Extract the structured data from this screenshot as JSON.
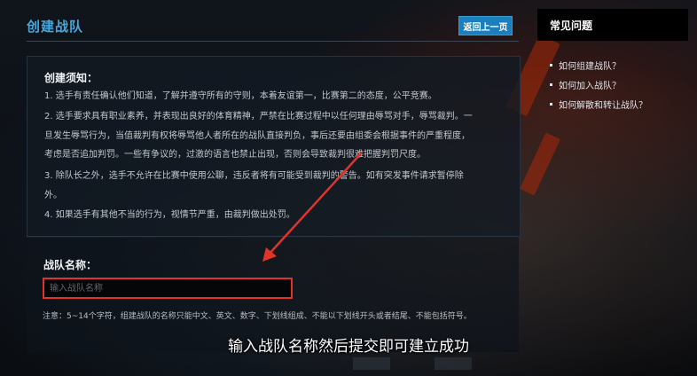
{
  "page": {
    "title": "创建战队",
    "back_button": "返回上一页"
  },
  "notice": {
    "heading": "创建须知：",
    "rules": [
      "1. 选手有责任确认他们知道，了解并遵守所有的守则，本着友谊第一，比赛第二的态度，公平竞赛。",
      "2. 选手要求具有职业素养，并表现出良好的体育精神，严禁在比赛过程中以任何理由辱骂对手，辱骂裁判。一",
      "旦发生辱骂行为，当值裁判有权将辱骂他人者所在的战队直接判负，事后还要由组委会根据事件的严重程度，",
      "考虑是否追加判罚。一些有争议的，过激的语言也禁止出现，否则会导致裁判很难把握判罚尺度。",
      "3. 除队长之外，选手不允许在比赛中使用公聊，违反者将有可能受到裁判的警告。如有突发事件请求暂停除",
      "外。",
      "4. 如果选手有其他不当的行为，视情节严重，由裁判做出处罚。"
    ]
  },
  "team_name": {
    "label": "战队名称：",
    "placeholder": "输入战队名称",
    "value": "",
    "hint": "注意：5~14个字符，组建战队的名称只能中文、英文、数字、下划线组成、不能以下划线开头或者结尾、不能包括符号。"
  },
  "faq": {
    "title": "常见问题",
    "items": [
      "如何组建战队？",
      "如何加入战队？",
      "如何解散和转让战队？"
    ]
  },
  "caption": "输入战队名称然后提交即可建立成功",
  "colors": {
    "accent_blue": "#4aa6d8",
    "button_blue": "#1b7fbd",
    "highlight_red": "#e0342a"
  }
}
